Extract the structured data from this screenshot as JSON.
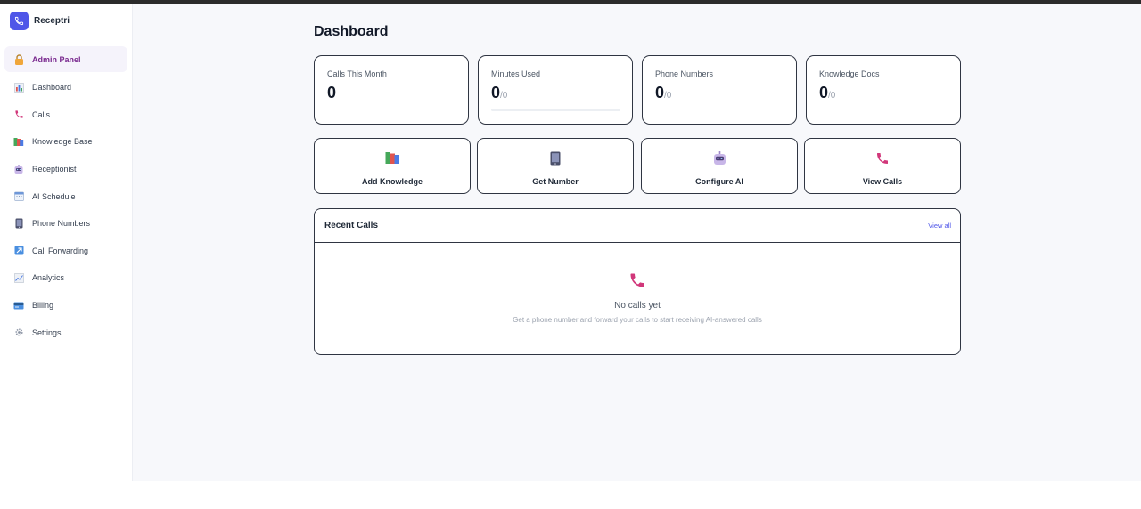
{
  "app": {
    "name": "Receptri"
  },
  "sidebar": {
    "admin_label": "Admin Panel",
    "items": [
      {
        "label": "Dashboard",
        "icon": "bar-chart-icon"
      },
      {
        "label": "Calls",
        "icon": "phone-icon"
      },
      {
        "label": "Knowledge Base",
        "icon": "books-icon"
      },
      {
        "label": "Receptionist",
        "icon": "robot-icon"
      },
      {
        "label": "AI Schedule",
        "icon": "calendar-icon"
      },
      {
        "label": "Phone Numbers",
        "icon": "mobile-icon"
      },
      {
        "label": "Call Forwarding",
        "icon": "forward-arrow-icon"
      },
      {
        "label": "Analytics",
        "icon": "line-chart-icon"
      },
      {
        "label": "Billing",
        "icon": "credit-card-icon"
      },
      {
        "label": "Settings",
        "icon": "gear-icon"
      }
    ]
  },
  "main": {
    "title": "Dashboard",
    "stats": [
      {
        "label": "Calls This Month",
        "value": "0",
        "sub": ""
      },
      {
        "label": "Minutes Used",
        "value": "0",
        "sub": "/0",
        "progress": 0
      },
      {
        "label": "Phone Numbers",
        "value": "0",
        "sub": "/0"
      },
      {
        "label": "Knowledge Docs",
        "value": "0",
        "sub": "/0"
      }
    ],
    "actions": [
      {
        "label": "Add Knowledge",
        "icon": "books-icon"
      },
      {
        "label": "Get Number",
        "icon": "mobile-icon"
      },
      {
        "label": "Configure AI",
        "icon": "robot-icon"
      },
      {
        "label": "View Calls",
        "icon": "phone-icon"
      }
    ],
    "recent_calls": {
      "title": "Recent Calls",
      "view_all": "View all",
      "empty_title": "No calls yet",
      "empty_subtitle": "Get a phone number and forward your calls to start receiving AI-answered calls"
    }
  },
  "colors": {
    "accent": "#4f56e8",
    "admin_text": "#7a2a8f",
    "phone_icon": "#d1377a",
    "card_border": "#2f3542"
  }
}
